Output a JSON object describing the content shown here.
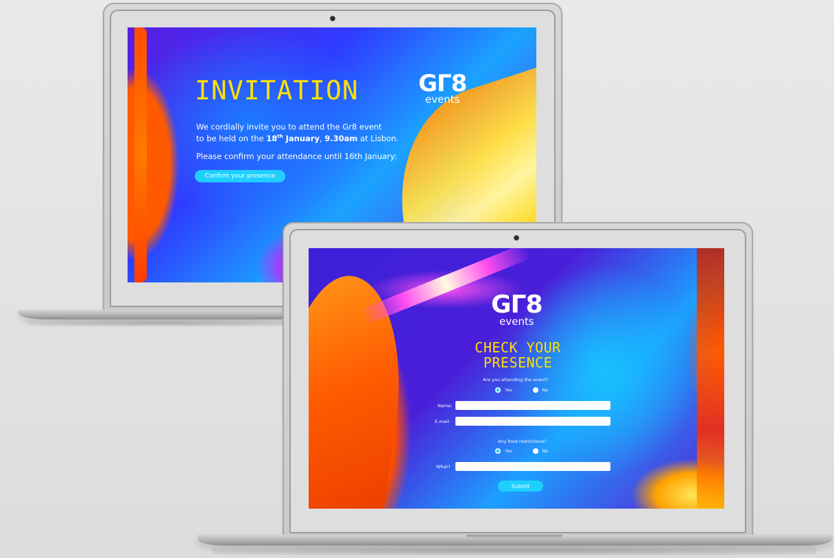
{
  "invitation_screen": {
    "title": "INVITATION",
    "logo": {
      "mark": "GΓ8",
      "sub": "events"
    },
    "text_line1": "We cordially invite you to attend the Gr8 event",
    "text_line2_prefix": "to be held on the ",
    "text_date_day": "18",
    "text_date_sup": "th",
    "text_date_rest": " January",
    "text_comma": ", ",
    "text_time": "9.30am",
    "text_location": " at Lisbon.",
    "text_confirm_line": "Please confirm your attendance until 16th January:",
    "confirm_button": "Confirm your presence"
  },
  "form_screen": {
    "logo": {
      "mark": "GΓ8",
      "sub": "events"
    },
    "title_line1": "CHECK YOUR",
    "title_line2": "PRESENCE",
    "attending_question": "Are you attending the event?",
    "attending_options": [
      "Yes",
      "No"
    ],
    "attending_selected": "Yes",
    "name_label": "Name:",
    "name_value": "",
    "email_label": "E-mail:",
    "email_value": "",
    "food_question": "Any food restrictions?",
    "food_options": [
      "Yes",
      "No"
    ],
    "food_selected": "Yes",
    "what_label": "What?",
    "what_value": "",
    "submit_button": "Submit"
  },
  "colors": {
    "title_yellow": "#ffe100",
    "button_cyan": "#1fd0ff",
    "background": "#e6e6e6"
  }
}
